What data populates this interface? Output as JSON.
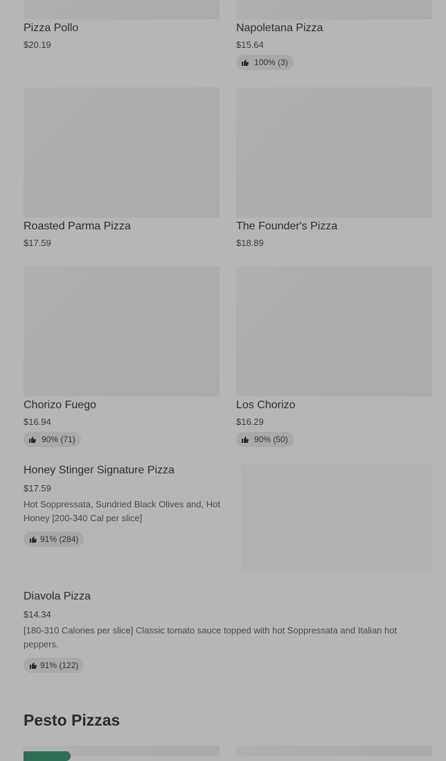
{
  "grid_items": [
    {
      "name": "Pizza Pollo",
      "price": "$20.19",
      "rating": ""
    },
    {
      "name": "Napoletana Pizza",
      "price": "$15.64",
      "rating": "100% (3)"
    },
    {
      "name": "Roasted Parma Pizza",
      "price": "$17.59",
      "rating": ""
    },
    {
      "name": "The Founder's Pizza",
      "price": "$18.89",
      "rating": ""
    },
    {
      "name": "Chorizo Fuego",
      "price": "$16.94",
      "rating": "90% (71)"
    },
    {
      "name": "Los Chorizo",
      "price": "$16.29",
      "rating": "90% (50)"
    }
  ],
  "list_items": [
    {
      "name": "Honey Stinger Signature Pizza",
      "price": "$17.59",
      "desc": "Hot Soppressata, Sundried Black Olives and, Hot Honey [200-340 Cal per slice]",
      "rating": "91% (284)"
    },
    {
      "name": "Diavola Pizza",
      "price": "$14.34",
      "desc": "[180-310 Calories per slice] Classic tomato sauce topped with hot Soppressata and Italian hot peppers.",
      "rating": "91% (122)"
    }
  ],
  "section": {
    "title": "Pesto Pizzas"
  },
  "icons": {
    "rating": "thumbs-up-icon"
  },
  "colors": {
    "overlay": "#b6b6b6",
    "tag": "#2e6e55"
  }
}
